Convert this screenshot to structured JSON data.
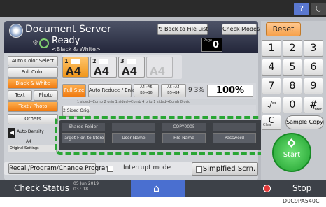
{
  "window": {
    "help_label": "?",
    "power_label": "⏾"
  },
  "header": {
    "title": "Document Server",
    "status": "Ready",
    "status_sub": "<Black & White>",
    "back_label": "Back to File List",
    "check_modes_label": "Check Modes",
    "pages_label": "Page",
    "pages_value": "0"
  },
  "color_menu": [
    "Auto Color Select",
    "Full Color",
    "Black & White"
  ],
  "side_buttons": {
    "text": "Text",
    "photo": "Photo",
    "text_photo": "Text / Photo",
    "others": "Others",
    "density": "Auto Density",
    "original_settings": "Original Settings",
    "orig_size": "A4"
  },
  "trays": [
    {
      "num": "1",
      "size": "A4"
    },
    {
      "num": "2",
      "size": "A4"
    },
    {
      "num": "3",
      "size": "A4"
    },
    {
      "num": "",
      "size": "A4"
    }
  ],
  "ratio": {
    "full_size": "Full Size",
    "auto_reduce": "Auto Reduce / Enlarge",
    "a4_a5": "A4→A5 B5→B6",
    "a5_a4": "A5→A4 B5→B4",
    "val_93": "9 3%",
    "val_100": "100%"
  },
  "sided": {
    "label": "2 Sided Orig.",
    "dims": "1 sided→Comb 2 orig 1 sided→Comb 4 orig 1 sided→Comb 8 orig"
  },
  "storage": {
    "shared_folder": "Shared Folder",
    "target_folder": "Target Fldr. to Store",
    "user_name": "User Name",
    "doc_id": "COPY0005",
    "file_name": "File Name",
    "password": "Password"
  },
  "bottom_bar": {
    "recall": "Recall/Program/Change Program",
    "interrupt": "Interrupt mode",
    "simplified": "Simplfied Scrn."
  },
  "keypad": {
    "reset": "Reset",
    "keys": [
      "1",
      "2",
      "3",
      "4",
      "5",
      "6",
      "7",
      "8",
      "9",
      "./*",
      "0",
      "#"
    ],
    "enter_sub": "Enter",
    "clear": "C",
    "clear_sub": "Clear",
    "sample_copy": "Sample Copy",
    "start": "Start"
  },
  "status_bar": {
    "check_status": "Check Status",
    "date": "05 Jun 2019",
    "time": "03 : 18",
    "stop": "Stop"
  },
  "caption": "D0C9PA540C"
}
